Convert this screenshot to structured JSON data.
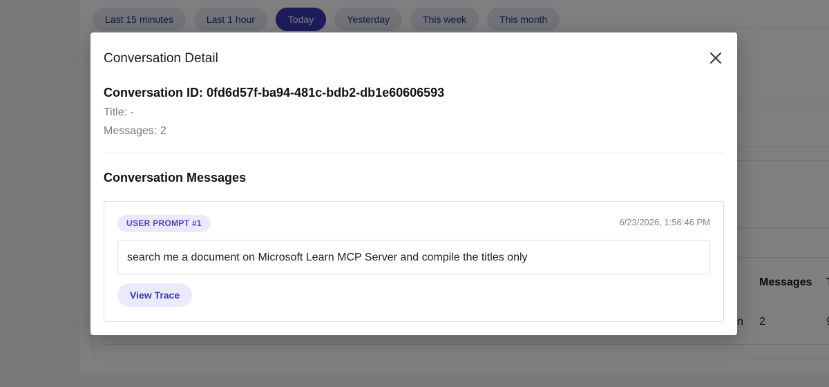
{
  "filters": [
    {
      "label": "Last 15 minutes",
      "active": false
    },
    {
      "label": "Last 1 hour",
      "active": false
    },
    {
      "label": "Today",
      "active": true
    },
    {
      "label": "Yesterday",
      "active": false
    },
    {
      "label": "This week",
      "active": false
    },
    {
      "label": "This month",
      "active": false
    }
  ],
  "background_table": {
    "header_messages": "Messages",
    "header_next_partial": "T",
    "row_cell_partial": "n",
    "row_messages": "2",
    "row_next_partial": "9"
  },
  "modal": {
    "title": "Conversation Detail",
    "conversation_id_label": "Conversation ID: 0fd6d57f-ba94-481c-bdb2-db1e60606593",
    "title_line": "Title: -",
    "messages_line": "Messages: 2",
    "section_title": "Conversation Messages",
    "messages": [
      {
        "badge": "USER PROMPT #1",
        "timestamp": "6/23/2026, 1:56:46 PM",
        "text": "search me a document on Microsoft Learn MCP Server and compile the titles only",
        "trace_label": "View Trace"
      }
    ]
  },
  "colors": {
    "accent": "#3b3bb8",
    "chip_bg": "#e6e7f5",
    "badge_bg": "#ebeafb",
    "overlay": "rgba(0,0,0,0.5)"
  },
  "icons": {
    "close": "close-icon"
  }
}
